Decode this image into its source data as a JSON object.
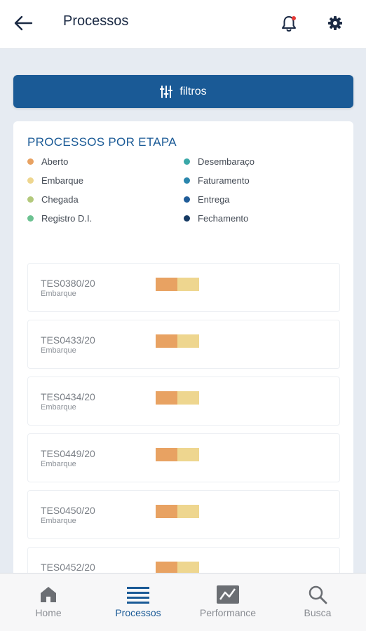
{
  "header": {
    "title": "Processos",
    "back_icon": "arrow-left-icon",
    "bell_icon": "bell-icon",
    "settings_icon": "gear-icon",
    "notification_color": "#e53935"
  },
  "filters": {
    "label": "filtros",
    "icon": "sliders-icon",
    "color": "#1a5a96"
  },
  "summary": {
    "title": "PROCESSOS POR ETAPA",
    "legend": [
      {
        "label": "Aberto",
        "color": "#e8a262"
      },
      {
        "label": "Embarque",
        "color": "#eed68f"
      },
      {
        "label": "Chegada",
        "color": "#b3c97c"
      },
      {
        "label": "Registro D.I.",
        "color": "#6cc291"
      },
      {
        "label": "Desembaraço",
        "color": "#3aa8a8"
      },
      {
        "label": "Faturamento",
        "color": "#2a86ad"
      },
      {
        "label": "Entrega",
        "color": "#1f5c98"
      },
      {
        "label": "Fechamento",
        "color": "#163a63"
      }
    ]
  },
  "processes": [
    {
      "id": "TES0380/20",
      "stage": "Embarque"
    },
    {
      "id": "TES0433/20",
      "stage": "Embarque"
    },
    {
      "id": "TES0434/20",
      "stage": "Embarque"
    },
    {
      "id": "TES0449/20",
      "stage": "Embarque"
    },
    {
      "id": "TES0450/20",
      "stage": "Embarque"
    },
    {
      "id": "TES0452/20",
      "stage": ""
    }
  ],
  "nav": [
    {
      "label": "Home",
      "icon": "home-icon",
      "active": false
    },
    {
      "label": "Processos",
      "icon": "list-icon",
      "active": true
    },
    {
      "label": "Performance",
      "icon": "chart-icon",
      "active": false
    },
    {
      "label": "Busca",
      "icon": "search-icon",
      "active": false
    }
  ]
}
